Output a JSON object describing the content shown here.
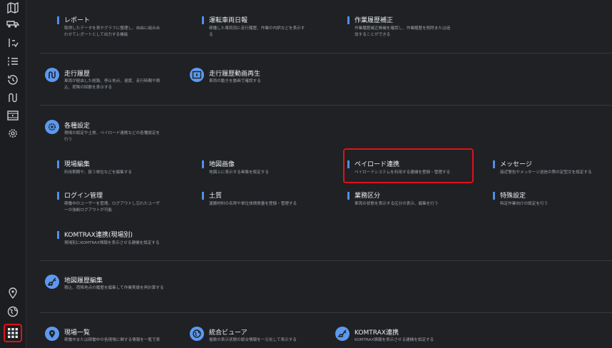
{
  "colors": {
    "accent": "#4f8fe8",
    "highlight": "#e0111b",
    "background": "#1f2124"
  },
  "rail": {
    "icons": [
      "map-icon",
      "truck-icon",
      "list-check-icon",
      "list-icon",
      "history-icon",
      "route-icon",
      "film-icon",
      "gear-icon",
      "location-pin-icon",
      "globe-icon",
      "apps-grid-icon"
    ]
  },
  "top": {
    "report": {
      "title": "レポート",
      "desc1": "取得したデータを表やグラフに整理し、自由に組み合",
      "desc2": "わせてレポートとして出力する機能"
    },
    "daily": {
      "title": "運転車両日報",
      "desc1": "稼働した車両別に走行履歴、作業の内訳などを表示す",
      "desc2": "る"
    },
    "correct": {
      "title": "作業履歴補正",
      "desc1": "作業履歴補正帳補を確認し、作業履歴を削除または追",
      "desc2": "加することができる"
    }
  },
  "history": {
    "route": {
      "title": "走行履歴",
      "desc1": "車両が経由した経路、停止地点、速度、走行時間や積",
      "desc2": "込、荷降の回数を表示する"
    },
    "video": {
      "title": "走行履歴動画再生",
      "desc1": "車両の動きを動画で確認する"
    }
  },
  "settings": {
    "title": "各種設定",
    "desc1": "現場の設定や土質、ペイロード連携などの各種設定を",
    "desc2": "行う",
    "items": {
      "site_edit": {
        "title": "現場編集",
        "desc": "利用期間や、扱う単位などを編集する"
      },
      "map_image": {
        "title": "地図画像",
        "desc": "地図上に表示する画像を設定する"
      },
      "payload": {
        "title": "ペイロード連携",
        "desc": "ペイロードシステムを利用する建機を登録・管理する"
      },
      "message": {
        "title": "メッセージ",
        "desc": "接近警告やメッセージ送信の際の定型文を設定する"
      },
      "login": {
        "title": "ログイン管理",
        "desc1": "稼働中のユーザーを管理。ログアウトし忘れたユーザ",
        "desc2": "ーの強制ログアウトが可能"
      },
      "soil": {
        "title": "土質",
        "desc": "運搬材料の名称や単位体積質量を登録・管理する"
      },
      "category": {
        "title": "業務区分",
        "desc": "車両の状態を表示する区分の表示、編集を行う"
      },
      "special": {
        "title": "特殊設定",
        "desc": "特定作業向けの設定を行う"
      },
      "komtrax_site": {
        "title": "KOMTRAX連携(現場別)",
        "desc": "現場別にKOMTRAX情報を表示させる建機を設定する"
      }
    }
  },
  "map_history": {
    "title": "地図履歴編集",
    "desc": "積込、荷降地点の履歴を編集して作業実績を再計算する"
  },
  "bottom": {
    "site_list": {
      "title": "現場一覧",
      "desc": "稼働中または稼働中の各現場に関する情報を一覧で表"
    },
    "viewer": {
      "title": "統合ビューア",
      "desc": "複数の表示状態の統合情報を一元化して表示する"
    },
    "komtrax": {
      "title": "KOMTRAX連携",
      "desc": "KOMTRAX情報を表示させる建機を設定する"
    }
  }
}
